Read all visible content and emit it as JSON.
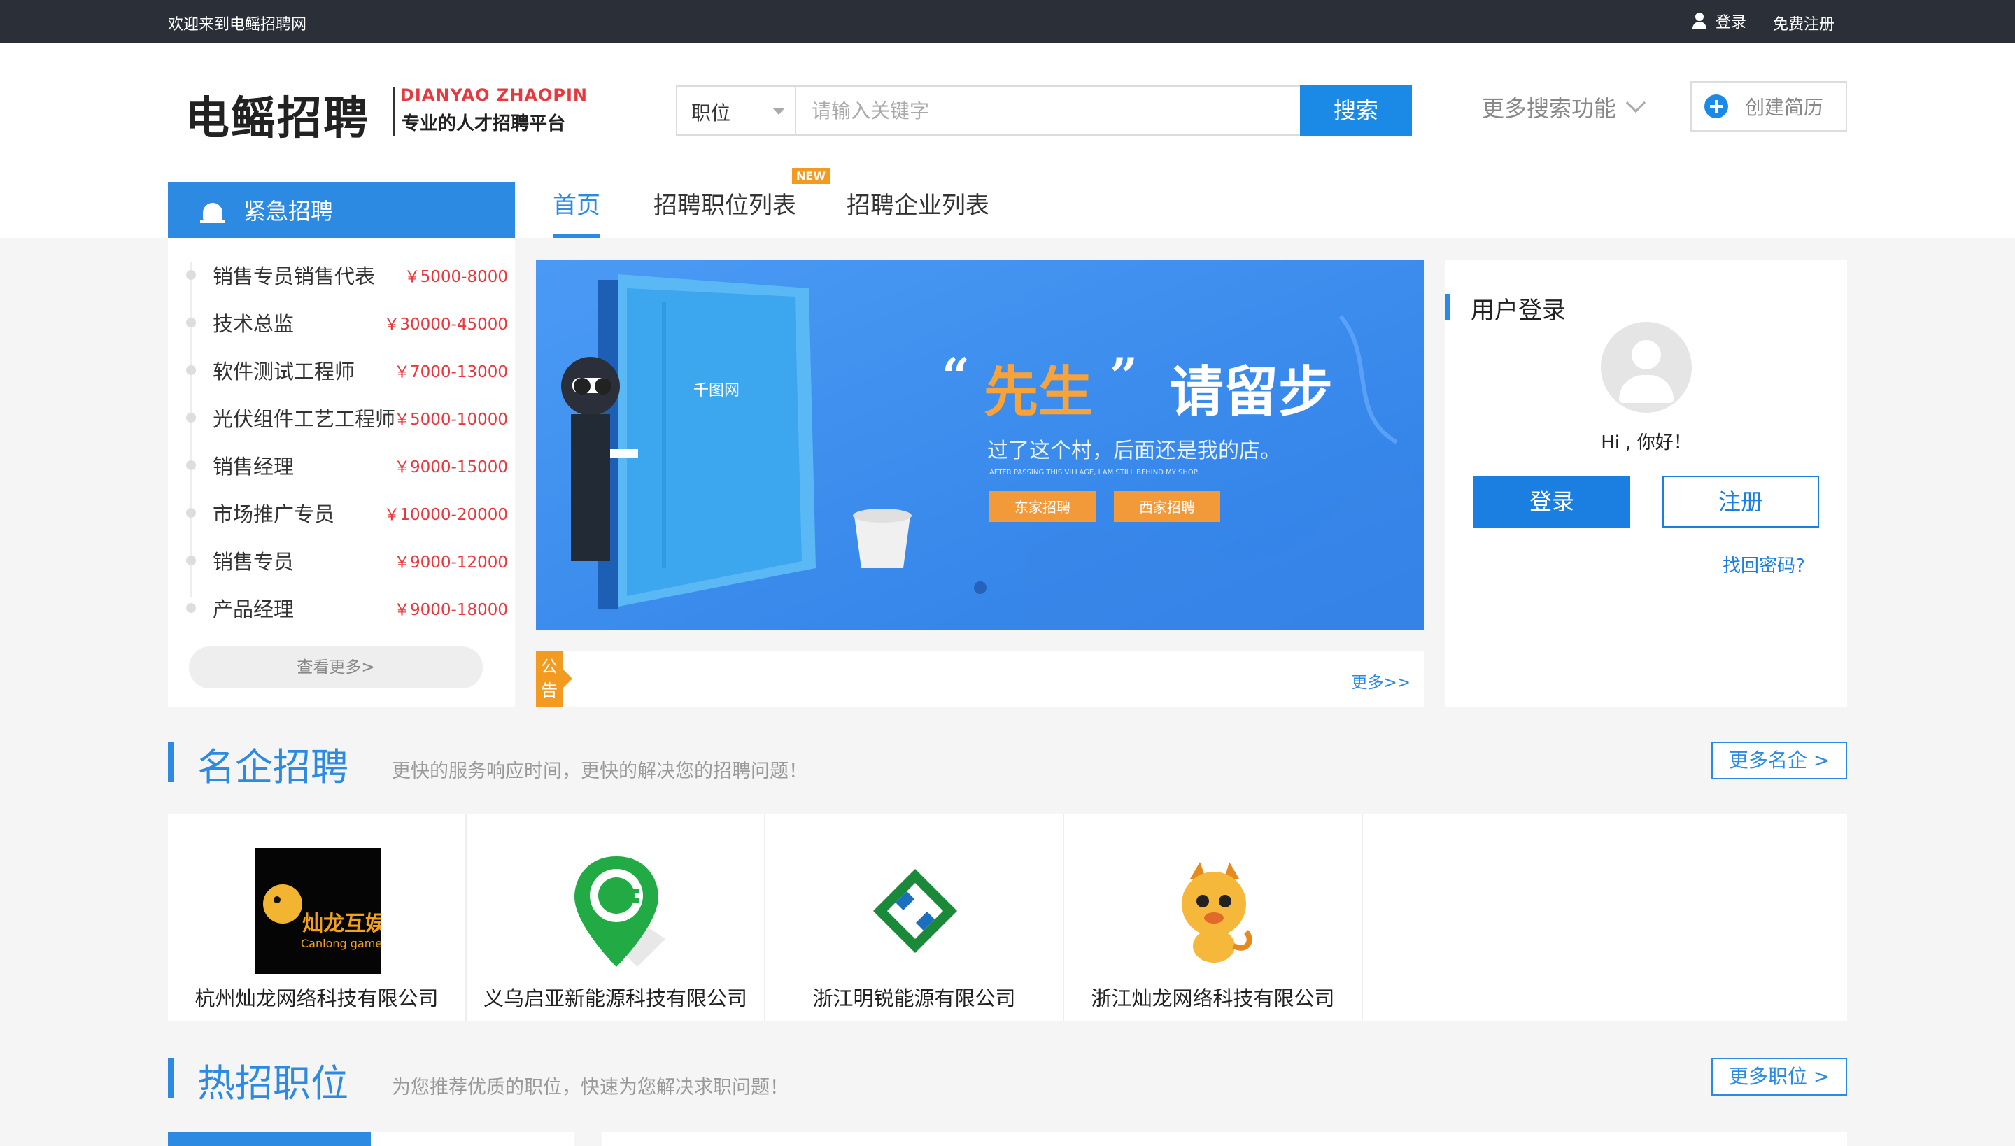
{
  "topbar": {
    "welcome": "欢迎来到电鳐招聘网",
    "login": "登录",
    "register": "免费注册"
  },
  "header": {
    "logo_cn": "电鳐招聘",
    "logo_en": "DIANYAO ZHAOPIN",
    "logo_slogan": "专业的人才招聘平台",
    "search_category": "职位",
    "search_placeholder": "请输入关键字",
    "search_button": "搜索",
    "more_search": "更多搜索功能",
    "create_resume": "创建简历"
  },
  "nav": {
    "urgent_title": "紧急招聘",
    "tabs": [
      {
        "label": "首页",
        "active": true
      },
      {
        "label": "招聘职位列表",
        "badge": "NEW"
      },
      {
        "label": "招聘企业列表"
      }
    ]
  },
  "urgent_jobs": [
    {
      "title": "销售专员销售代表",
      "salary": "￥5000-8000"
    },
    {
      "title": "技术总监",
      "salary": "￥30000-45000"
    },
    {
      "title": "软件测试工程师",
      "salary": "￥7000-13000"
    },
    {
      "title": "光伏组件工艺工程师",
      "salary": "￥5000-10000"
    },
    {
      "title": "销售经理",
      "salary": "￥9000-15000"
    },
    {
      "title": "市场推广专员",
      "salary": "￥10000-20000"
    },
    {
      "title": "销售专员",
      "salary": "￥9000-12000"
    },
    {
      "title": "产品经理",
      "salary": "￥9000-18000"
    }
  ],
  "urgent_more": "查看更多>",
  "banner": {
    "headline_quote_word": "先生",
    "headline_rest": "请留步",
    "subline": "过了这个村，后面还是我的店。",
    "tiny_text": "AFTER PASSING THIS VILLAGE, I AM STILL BEHIND MY SHOP.",
    "btn_left": "东家招聘",
    "btn_right": "西家招聘",
    "door_brand": "千图网"
  },
  "notice": {
    "tag": "公告",
    "more": "更多>>"
  },
  "login_panel": {
    "title": "用户登录",
    "greeting": "Hi , 你好！",
    "login_btn": "登录",
    "register_btn": "注册",
    "forgot": "找回密码?"
  },
  "famous": {
    "title": "名企招聘",
    "subtitle": "更快的服务响应时间，更快的解决您的招聘问题！",
    "more": "更多名企 >",
    "companies": [
      {
        "name": "杭州灿龙网络科技有限公司",
        "logo_text": "灿龙互娱",
        "logo_sub": "Canlong game"
      },
      {
        "name": "义乌启亚新能源科技有限公司"
      },
      {
        "name": "浙江明锐能源有限公司"
      },
      {
        "name": "浙江灿龙网络科技有限公司"
      }
    ]
  },
  "hot": {
    "title": "热招职位",
    "subtitle": "为您推荐优质的职位，快速为您解决求职问题！",
    "more": "更多职位 >"
  },
  "colors": {
    "accent": "#2d8ae2",
    "topbar": "#2b2f38",
    "salary": "#e8383d",
    "badge": "#f39a21"
  }
}
